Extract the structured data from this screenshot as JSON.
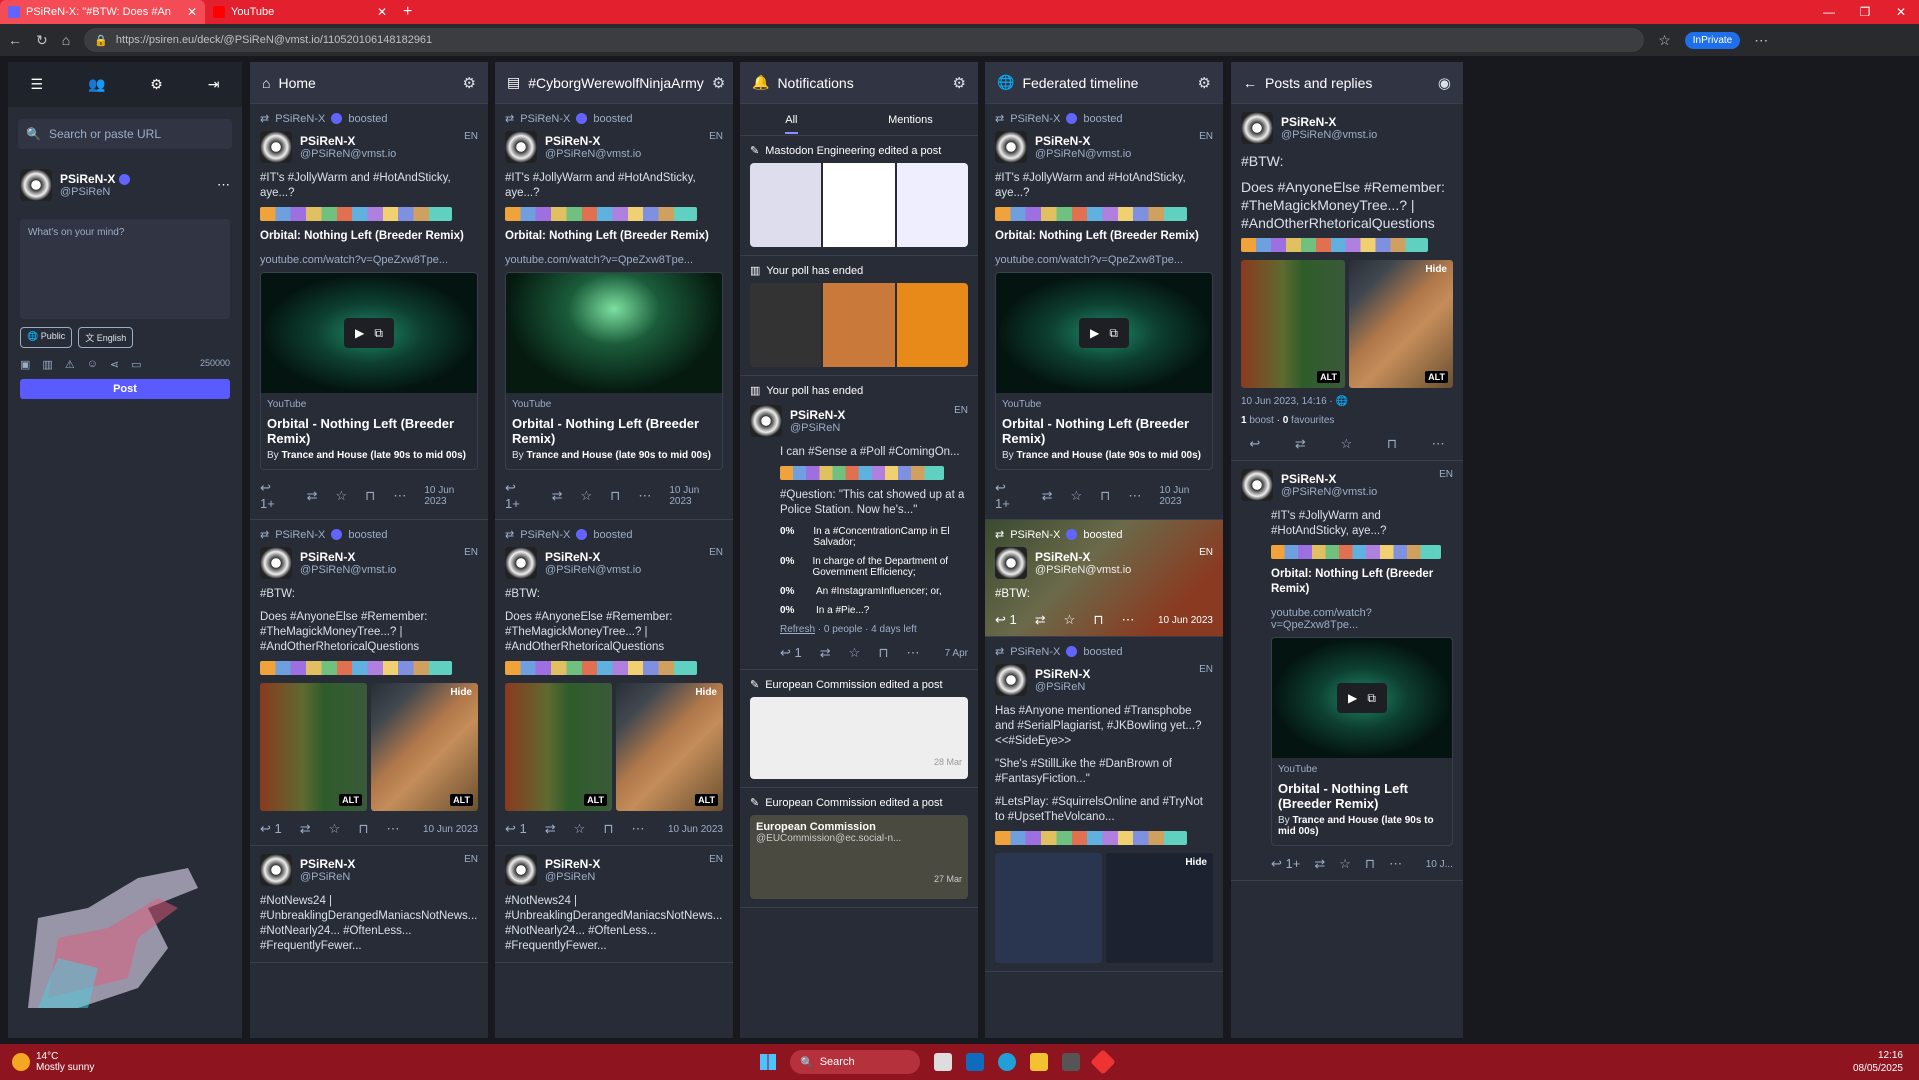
{
  "browser": {
    "tab1_title": "PSiReN-X: \"#BTW: Does #An",
    "tab2_title": "YouTube",
    "url": "https://psiren.eu/deck/@PSiReN@vmst.io/110520106148182961",
    "inprivate": "InPrivate"
  },
  "sidebar": {
    "search_placeholder": "Search or paste URL",
    "display_name": "PSiReN-X",
    "acct": "@PSiReN",
    "compose_placeholder": "What's on your mind?",
    "visibility": "Public",
    "language": "English",
    "char_count": "250000",
    "post_label": "Post"
  },
  "columns": {
    "home": "Home",
    "hashtag": "#CyborgWerewolfNinjaArmy",
    "notifications": "Notifications",
    "federated": "Federated timeline",
    "posts": "Posts and replies"
  },
  "common": {
    "boosted_by": "PSiReN-X",
    "boosted": "boosted",
    "display_name": "PSiReN-X",
    "acct_full": "@PSiReN@vmst.io",
    "acct_short": "@PSiReN",
    "lang": "EN",
    "post1_text": "#IT's #JollyWarm and #HotAndSticky, aye...?",
    "post1_title": "Orbital: Nothing Left (Breeder Remix)",
    "post1_link": "youtube.com/watch?v=QpeZxw8Tpe...",
    "card_source": "YouTube",
    "card_title": "Orbital - Nothing Left (Breeder Remix)",
    "card_by": "By",
    "card_author": "Trance and House (late 90s to mid 00s)",
    "reply_count": "1+",
    "date": "10 Jun 2023",
    "post2_btw": "#BTW:",
    "post2_text": "Does #AnyoneElse #Remember: #TheMagickMoneyTree...? | #AndOtherRhetoricalQuestions",
    "alt": "ALT",
    "hide": "Hide",
    "reply_one": "1",
    "post3_text": "#NotNews24 | #UnbreaklingDerangedManiacsNotNews... #NotNearly24... #OftenLess... #FrequentlyFewer..."
  },
  "notifications": {
    "tab_all": "All",
    "tab_mentions": "Mentions",
    "n1": "Mastodon Engineering edited a post",
    "n2": "Your poll has ended",
    "n3": "Your poll has ended",
    "poll_text": "I can #Sense a #Poll #ComingOn...",
    "poll_question": "#Question: \"This cat showed up at a Police Station. Now he's...\"",
    "options": [
      {
        "pct": "0%",
        "label": "In a #ConcentrationCamp in El Salvador;"
      },
      {
        "pct": "0%",
        "label": "In charge of the Department of Government Efficiency;"
      },
      {
        "pct": "0%",
        "label": "An #InstagramInfluencer; or,"
      },
      {
        "pct": "0%",
        "label": "In a #Pie...?"
      }
    ],
    "refresh": "Refresh",
    "poll_meta": "· 0 people · 4 days left",
    "poll_date": "7 Apr",
    "n4": "European Commission edited a post",
    "n4_date": "28 Mar",
    "n5": "European Commission edited a post",
    "n5_name": "European Commission",
    "n5_acct": "@EUCommission@ec.social-n...",
    "n5_date": "27 Mar"
  },
  "federated": {
    "post3_text": "Has #Anyone mentioned #Transphobe and #SerialPlagiarist, #JKBowling yet...? <<#SideEye>>",
    "post3_b": "\"She's #StillLike the #DanBrown of #FantasyFiction...\"",
    "post3_c": "#LetsPlay: #SquirrelsOnline and #TryNot to #UpsetTheVolcano..."
  },
  "detail": {
    "btw": "#BTW:",
    "text": "Does #AnyoneElse #Remember: #TheMagickMoneyTree...? | #AndOtherRhetoricalQuestions",
    "timestamp": "10 Jun 2023, 14:16",
    "boost_count": "1",
    "boost_label": "boost",
    "fav_count": "0",
    "fav_label": "favourites",
    "date_short": "10 J..."
  },
  "taskbar": {
    "temp": "14°C",
    "weather": "Mostly sunny",
    "search": "Search",
    "time": "12:16",
    "date": "08/05/2025"
  }
}
